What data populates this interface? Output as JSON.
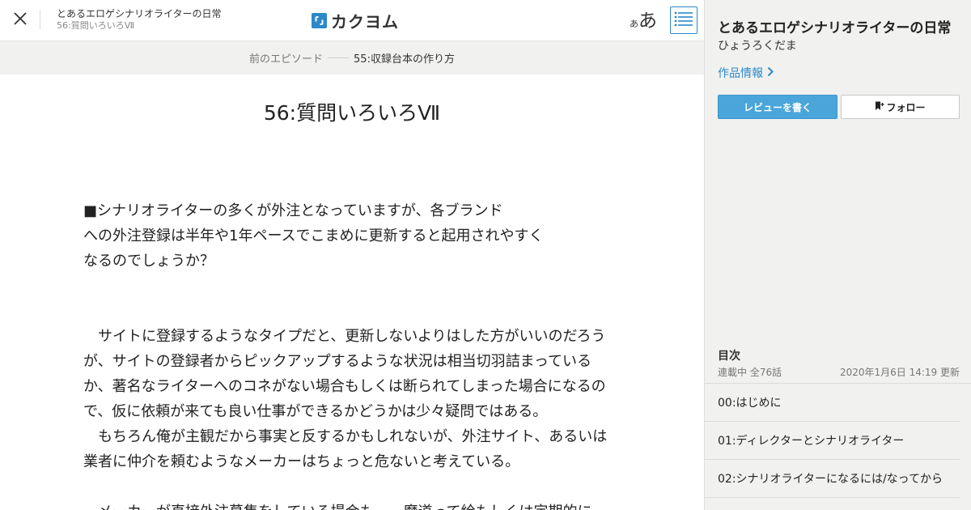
{
  "header": {
    "work_title": "とあるエロゲシナリオライターの日常",
    "episode_title": "56:質問いろいろⅦ",
    "logo_text": "カクヨム",
    "font_size_small": "あ",
    "font_size_large": "あ",
    "close_icon": "close-icon",
    "toc_icon": "list-icon"
  },
  "prev_episode": {
    "label": "前のエピソード",
    "title": "55:収録台本の作り方"
  },
  "episode": {
    "heading": "56:質問いろいろⅦ",
    "lines": [
      "■シナリオライターの多くが外注となっていますが、各ブランド",
      "への外注登録は半年や1年ペースでこまめに更新すると起用されやすく",
      "なるのでしょうか？",
      "",
      "",
      "　サイトに登録するようなタイプだと、更新しないよりはした方がいいのだろう",
      "が、サイトの登録者からピックアップするような状況は相当切羽詰まっている",
      "か、著名なライターへのコネがない場合もしくは断られてしまった場合になるの",
      "で、仮に依頼が来ても良い仕事ができるかどうかは少々疑問ではある。",
      "　もちろん俺が主観だから事実と反するかもしれないが、外注サイト、あるいは",
      "業者に仲介を頼むようなメーカーはちょっと危ないと考えている。",
      "",
      "　メーカーが直接外注募集をしている場合も……魔道って絵もしくは定期的に"
    ]
  },
  "sidebar": {
    "work_title": "とあるエロゲシナリオライターの日常",
    "author": "ひょうろくだま",
    "info_link": "作品情報",
    "review_button": "レビューを書く",
    "follow_button": "フォロー",
    "toc_heading": "目次",
    "toc_status": "連載中 全76話",
    "toc_updated": "2020年1月6日 14:19 更新",
    "toc_items": [
      "00:はじめに",
      "01:ディレクターとシナリオライター",
      "02:シナリオライターになるには/なってから"
    ]
  },
  "colors": {
    "accent": "#2b89c9",
    "review_button_bg": "#4aa6da",
    "sidebar_bg": "#f1f1ef",
    "prev_bar_bg": "#f1f1ef"
  }
}
